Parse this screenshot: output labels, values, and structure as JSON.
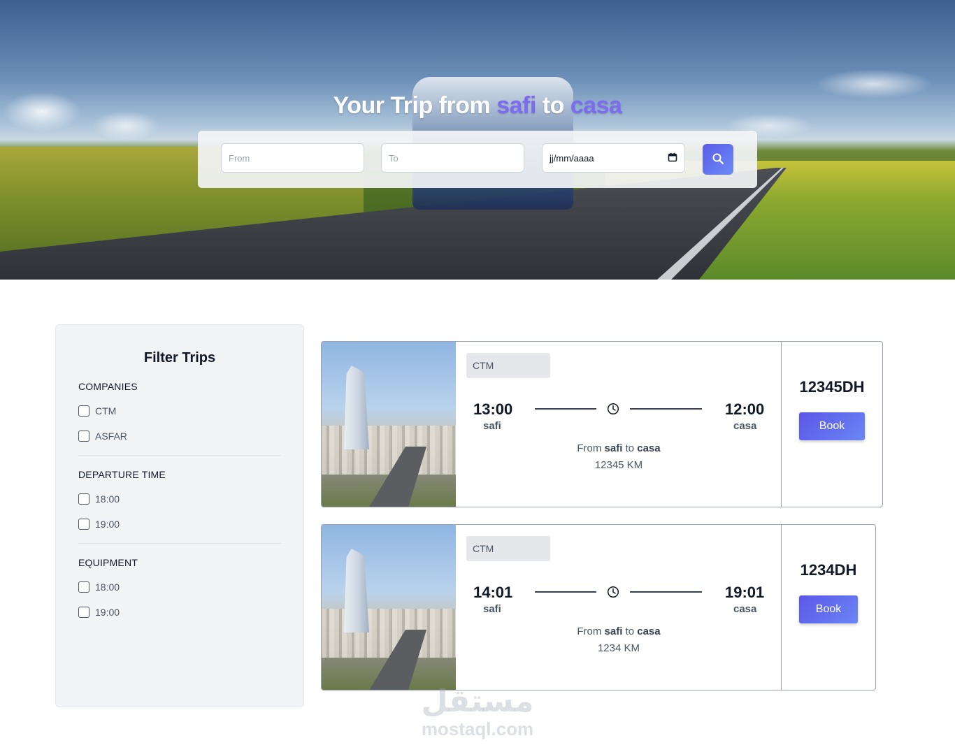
{
  "hero": {
    "title_prefix": "Your Trip from",
    "from_city": "safi",
    "title_mid": "to",
    "to_city": "casa"
  },
  "search": {
    "from_placeholder": "From",
    "to_placeholder": "To",
    "date_placeholder": "jj/mm/aaaa",
    "search_icon": "search-icon",
    "calendar_icon": "calendar-icon"
  },
  "sidebar": {
    "title": "Filter Trips",
    "groups": [
      {
        "title": "COMPANIES",
        "options": [
          "CTM",
          "ASFAR"
        ]
      },
      {
        "title": "DEPARTURE TIME",
        "options": [
          "18:00",
          "19:00"
        ]
      },
      {
        "title": "EQUIPMENT",
        "options": [
          "18:00",
          "19:00"
        ]
      }
    ]
  },
  "trips": [
    {
      "company": "CTM",
      "depart_time": "13:00",
      "arrive_time": "12:00",
      "from": "safi",
      "to": "casa",
      "route_from_label": "From",
      "route_to_label": "to",
      "distance": "12345 KM",
      "price": "12345DH",
      "book_label": "Book"
    },
    {
      "company": "CTM",
      "depart_time": "14:01",
      "arrive_time": "19:01",
      "from": "safi",
      "to": "casa",
      "route_from_label": "From",
      "route_to_label": "to",
      "distance": "1234 KM",
      "price": "1234DH",
      "book_label": "Book"
    }
  ],
  "watermark": {
    "arabic": "مستقل",
    "latin": "mostaql.com"
  },
  "colors": {
    "accent": "#5b5bea",
    "accent_light": "#6b8bf5",
    "highlight": "#7c6cf0"
  }
}
